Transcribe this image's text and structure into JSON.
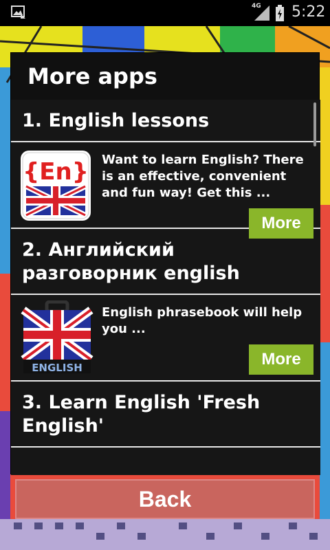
{
  "status_bar": {
    "network": "4G",
    "time": "5:22"
  },
  "dialog": {
    "title": "More apps",
    "apps": [
      {
        "header": "1. English lessons",
        "description": "Want to learn English? There is an effective, convenient and fun way! Get this ...",
        "more_label": "More",
        "icon": "en-flag-icon",
        "icon_text": "{En}"
      },
      {
        "header": "2. Английский разговорник english",
        "description": "English phrasebook will help you ...",
        "more_label": "More",
        "icon": "suitcase-flag-icon",
        "icon_text": "ENGLISH"
      },
      {
        "header": "3. Learn English 'Fresh English'"
      }
    ]
  },
  "back_label": "Back",
  "colors": {
    "more_button": "#8ab62a",
    "back_button": "#c9655e",
    "dialog_bg": "#101010"
  }
}
